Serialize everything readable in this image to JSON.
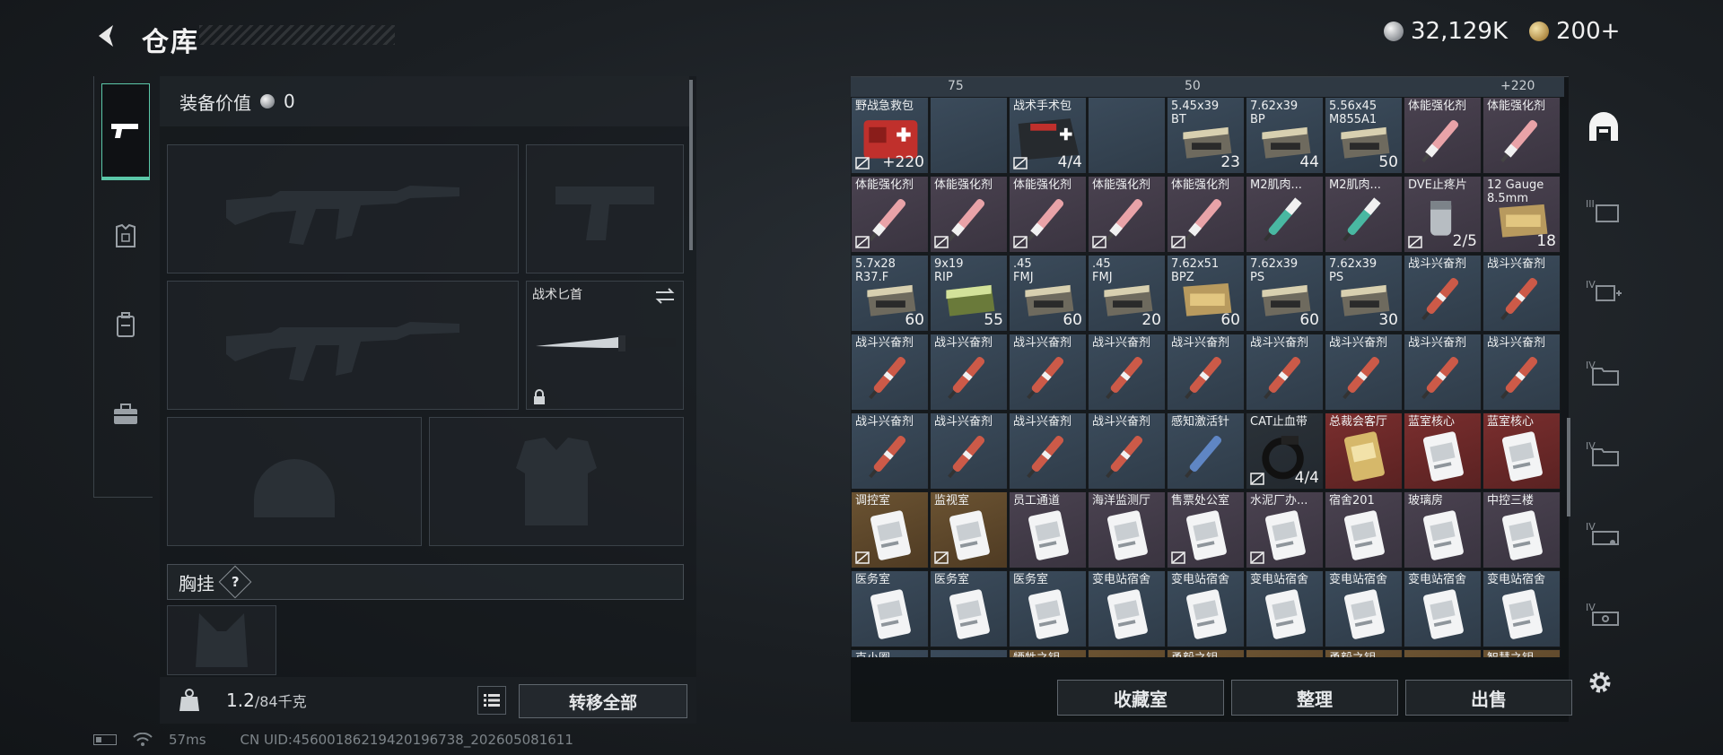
{
  "header": {
    "title": "仓库",
    "currency_silver": "32,129K",
    "currency_gold": "200+"
  },
  "equipment": {
    "value_label": "装备价值",
    "value": "0",
    "knife_label": "战术匕首",
    "chest_label": "胸挂",
    "chest_help": "?",
    "weight_current": "1.2",
    "weight_max": "/84千克",
    "transfer_all": "转移全部"
  },
  "status": {
    "ping": "57ms",
    "uid": "CN UID:456001862194201967​38_20260508​1611"
  },
  "storage": {
    "top_strip": [
      "",
      "75",
      "",
      "50",
      "",
      "+220"
    ],
    "items": [
      {
        "name": "野战急救包",
        "count": "+220",
        "style": "default",
        "art": "medkit-red",
        "mark": true
      },
      {
        "name": "",
        "count": "",
        "style": "default",
        "art": "none",
        "mark": false
      },
      {
        "name": "战术手术包",
        "count": "4/4",
        "style": "default",
        "art": "surgery-kit",
        "mark": true
      },
      {
        "name": "",
        "count": "",
        "style": "default",
        "art": "none",
        "mark": false
      },
      {
        "name": "5.45x39\nBT",
        "count": "23",
        "style": "default",
        "art": "ammo-box",
        "mark": false
      },
      {
        "name": "7.62x39\nBP",
        "count": "44",
        "style": "default",
        "art": "ammo-box",
        "mark": false
      },
      {
        "name": "5.56x45\nM855A1",
        "count": "50",
        "style": "default",
        "art": "ammo-box",
        "mark": false
      },
      {
        "name": "体能强化剂",
        "count": "",
        "style": "purple",
        "art": "injector-pink",
        "mark": false
      },
      {
        "name": "体能强化剂",
        "count": "",
        "style": "purple",
        "art": "injector-pink",
        "mark": false
      },
      {
        "name": "体能强化剂",
        "count": "",
        "style": "purple",
        "art": "injector-pink",
        "mark": true
      },
      {
        "name": "体能强化剂",
        "count": "",
        "style": "purple",
        "art": "injector-pink",
        "mark": true
      },
      {
        "name": "体能强化剂",
        "count": "",
        "style": "purple",
        "art": "injector-pink",
        "mark": true
      },
      {
        "name": "体能强化剂",
        "count": "",
        "style": "purple",
        "art": "injector-pink",
        "mark": true
      },
      {
        "name": "体能强化剂",
        "count": "",
        "style": "purple",
        "art": "injector-pink",
        "mark": true
      },
      {
        "name": "M2肌肉...",
        "count": "",
        "style": "purple",
        "art": "injector-teal",
        "mark": false
      },
      {
        "name": "M2肌肉...",
        "count": "",
        "style": "purple",
        "art": "injector-teal",
        "mark": false
      },
      {
        "name": "DVE止疼片",
        "count": "2/5",
        "style": "purple",
        "art": "pills",
        "mark": true
      },
      {
        "name": "12 Gauge\n8.5mm",
        "count": "18",
        "style": "purple",
        "art": "ammo-box-gold",
        "mark": false
      },
      {
        "name": "5.7x28\nR37.F",
        "count": "60",
        "style": "default",
        "art": "ammo-box",
        "mark": false
      },
      {
        "name": "9x19\nRIP",
        "count": "55",
        "style": "default",
        "art": "ammo-box-green",
        "mark": false
      },
      {
        "name": ".45\nFMJ",
        "count": "60",
        "style": "default",
        "art": "ammo-box",
        "mark": false
      },
      {
        "name": ".45\nFMJ",
        "count": "20",
        "style": "default",
        "art": "ammo-box",
        "mark": false
      },
      {
        "name": "7.62x51\nBPZ",
        "count": "60",
        "style": "default",
        "art": "ammo-box-gold",
        "mark": false
      },
      {
        "name": "7.62x39\nPS",
        "count": "60",
        "style": "default",
        "art": "ammo-box",
        "mark": false
      },
      {
        "name": "7.62x39\nPS",
        "count": "30",
        "style": "default",
        "art": "ammo-box",
        "mark": false
      },
      {
        "name": "战斗兴奋剂",
        "count": "",
        "style": "default",
        "art": "injector-red",
        "mark": false
      },
      {
        "name": "战斗兴奋剂",
        "count": "",
        "style": "default",
        "art": "injector-red",
        "mark": false
      },
      {
        "name": "战斗兴奋剂",
        "count": "",
        "style": "default",
        "art": "injector-red",
        "mark": false
      },
      {
        "name": "战斗兴奋剂",
        "count": "",
        "style": "default",
        "art": "injector-red",
        "mark": false
      },
      {
        "name": "战斗兴奋剂",
        "count": "",
        "style": "default",
        "art": "injector-red",
        "mark": false
      },
      {
        "name": "战斗兴奋剂",
        "count": "",
        "style": "default",
        "art": "injector-red",
        "mark": false
      },
      {
        "name": "战斗兴奋剂",
        "count": "",
        "style": "default",
        "art": "injector-red",
        "mark": false
      },
      {
        "name": "战斗兴奋剂",
        "count": "",
        "style": "default",
        "art": "injector-red",
        "mark": false
      },
      {
        "name": "战斗兴奋剂",
        "count": "",
        "style": "default",
        "art": "injector-red",
        "mark": false
      },
      {
        "name": "战斗兴奋剂",
        "count": "",
        "style": "default",
        "art": "injector-red",
        "mark": false
      },
      {
        "name": "战斗兴奋剂",
        "count": "",
        "style": "default",
        "art": "injector-red",
        "mark": false
      },
      {
        "name": "战斗兴奋剂",
        "count": "",
        "style": "default",
        "art": "injector-red",
        "mark": false
      },
      {
        "name": "战斗兴奋剂",
        "count": "",
        "style": "default",
        "art": "injector-red",
        "mark": false
      },
      {
        "name": "战斗兴奋剂",
        "count": "",
        "style": "default",
        "art": "injector-red",
        "mark": false
      },
      {
        "name": "战斗兴奋剂",
        "count": "",
        "style": "default",
        "art": "injector-red",
        "mark": false
      },
      {
        "name": "感知激活针",
        "count": "",
        "style": "default",
        "art": "injector-blue",
        "mark": false
      },
      {
        "name": "CAT止血带",
        "count": "4/4",
        "style": "dark",
        "art": "tourniquet",
        "mark": true
      },
      {
        "name": "总裁会客厅",
        "count": "",
        "style": "red",
        "art": "keycard-gold",
        "mark": false
      },
      {
        "name": "蓝室核心",
        "count": "",
        "style": "red",
        "art": "keycard",
        "mark": false
      },
      {
        "name": "蓝室核心",
        "count": "",
        "style": "red",
        "art": "keycard",
        "mark": false
      },
      {
        "name": "调控室",
        "count": "",
        "style": "gold",
        "art": "keycard",
        "mark": true
      },
      {
        "name": "监视室",
        "count": "",
        "style": "gold",
        "art": "keycard",
        "mark": true
      },
      {
        "name": "员工通道",
        "count": "",
        "style": "purple",
        "art": "keycard",
        "mark": false
      },
      {
        "name": "海洋监测厅",
        "count": "",
        "style": "purple",
        "art": "keycard",
        "mark": false
      },
      {
        "name": "售票处公室",
        "count": "",
        "style": "purple",
        "art": "keycard",
        "mark": true
      },
      {
        "name": "水泥厂办...",
        "count": "",
        "style": "purple",
        "art": "keycard",
        "mark": true
      },
      {
        "name": "宿舍201",
        "count": "",
        "style": "purple",
        "art": "keycard",
        "mark": false
      },
      {
        "name": "玻璃房",
        "count": "",
        "style": "purple",
        "art": "keycard",
        "mark": false
      },
      {
        "name": "中控三楼",
        "count": "",
        "style": "purple",
        "art": "keycard",
        "mark": false
      },
      {
        "name": "医务室",
        "count": "",
        "style": "default",
        "art": "keycard",
        "mark": false
      },
      {
        "name": "医务室",
        "count": "",
        "style": "default",
        "art": "keycard",
        "mark": false
      },
      {
        "name": "医务室",
        "count": "",
        "style": "default",
        "art": "keycard",
        "mark": false
      },
      {
        "name": "变电站宿舍",
        "count": "",
        "style": "default",
        "art": "keycard",
        "mark": false
      },
      {
        "name": "变电站宿舍",
        "count": "",
        "style": "default",
        "art": "keycard",
        "mark": false
      },
      {
        "name": "变电站宿舍",
        "count": "",
        "style": "default",
        "art": "keycard",
        "mark": false
      },
      {
        "name": "变电站宿舍",
        "count": "",
        "style": "default",
        "art": "keycard",
        "mark": false
      },
      {
        "name": "变电站宿舍",
        "count": "",
        "style": "default",
        "art": "keycard",
        "mark": false
      },
      {
        "name": "变电站宿舍",
        "count": "",
        "style": "default",
        "art": "keycard",
        "mark": false
      },
      {
        "name": "克小圈",
        "count": "",
        "style": "default",
        "art": "none",
        "mark": false
      },
      {
        "name": "",
        "count": "",
        "style": "default",
        "art": "none",
        "mark": false
      },
      {
        "name": "牺牲之钥",
        "count": "",
        "style": "gold",
        "art": "none",
        "mark": false
      },
      {
        "name": "",
        "count": "",
        "style": "gold",
        "art": "none",
        "mark": false
      },
      {
        "name": "勇毅之钥",
        "count": "",
        "style": "gold",
        "art": "none",
        "mark": false
      },
      {
        "name": "",
        "count": "",
        "style": "gold",
        "art": "none",
        "mark": false
      },
      {
        "name": "勇毅之钥",
        "count": "",
        "style": "gold",
        "art": "none",
        "mark": false
      },
      {
        "name": "",
        "count": "",
        "style": "gold",
        "art": "none",
        "mark": false
      },
      {
        "name": "智慧之钥",
        "count": "",
        "style": "gold",
        "art": "none",
        "mark": false
      }
    ],
    "buttons": {
      "collection": "收藏室",
      "organize": "整理",
      "sell": "出售"
    }
  },
  "right_tabs": [
    "home-tab",
    "tab-III",
    "tab-IV-plus",
    "tab-IV-folder",
    "tab-IV-folder-2",
    "tab-IV-card",
    "tab-IV-ticket"
  ],
  "colors": {
    "accent": "#5bc7a8",
    "cell_default": "#34424f",
    "cell_purple": "#433c49",
    "cell_red": "#6a2828",
    "cell_gold": "#5d472b"
  }
}
